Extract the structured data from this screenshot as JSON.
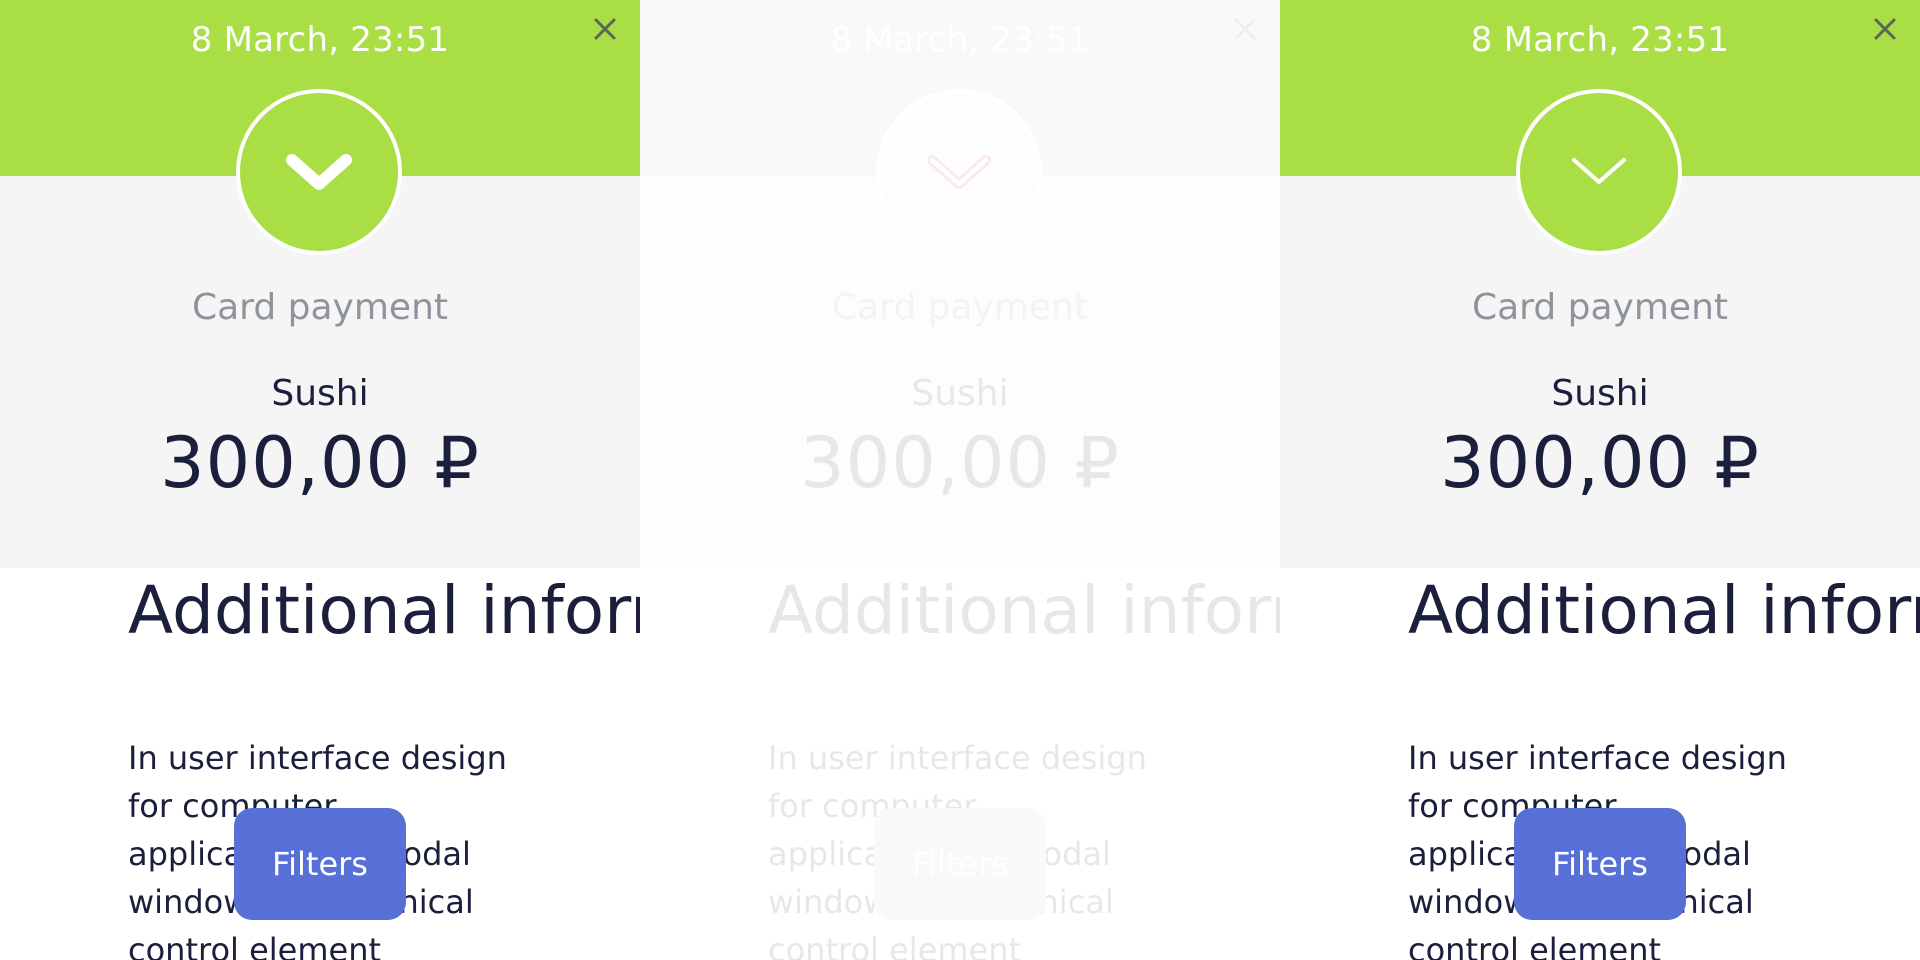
{
  "colors": {
    "header_green": "#a9de44",
    "card_bg": "#f5f5f5",
    "primary_text": "#1c1f3b",
    "secondary_text": "#8e939c",
    "button_blue": "#5670d8",
    "chevron_red": "#e62a12"
  },
  "panels": [
    {
      "date": "8 March, 23:51",
      "close_icon": "close-icon",
      "status_icon": "chevron-down-bold-icon",
      "payment_type": "Card payment",
      "merchant": "Sushi",
      "amount": "300,00 ₽",
      "section_title": "Additional information",
      "section_body": "In user interface design for computer applications, a modal window is a graphical control element",
      "filters_label": "Filters"
    },
    {
      "date": "8 March, 23:51",
      "close_icon": "close-icon",
      "status_icon": "chevron-down-red-outline-icon",
      "payment_type": "Card payment",
      "merchant": "Sushi",
      "amount": "300,00 ₽",
      "section_title": "Additional information",
      "section_body": "In user interface design for computer applications, a modal window is a graphical control element",
      "filters_label": "Filters"
    },
    {
      "date": "8 March, 23:51",
      "close_icon": "close-icon",
      "status_icon": "chevron-down-thin-icon",
      "payment_type": "Card payment",
      "merchant": "Sushi",
      "amount": "300,00 ₽",
      "section_title": "Additional information",
      "section_body": "In user interface design for computer applications, a modal window is a graphical control element",
      "filters_label": "Filters"
    }
  ]
}
